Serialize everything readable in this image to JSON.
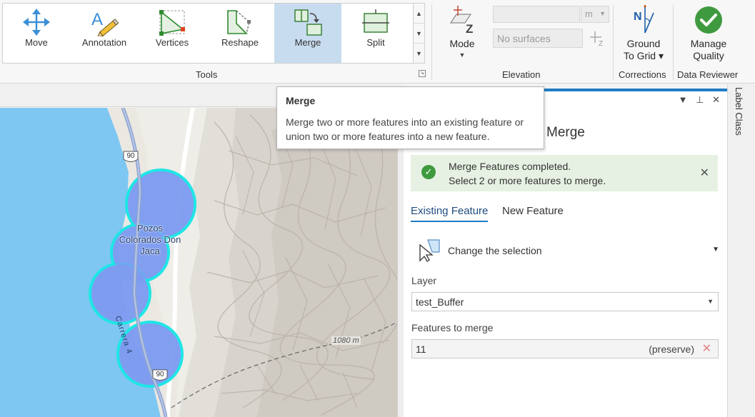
{
  "ribbon": {
    "tools": [
      {
        "label": "Move",
        "icon": "move-icon"
      },
      {
        "label": "Annotation",
        "icon": "annotation-icon"
      },
      {
        "label": "Vertices",
        "icon": "vertices-icon"
      },
      {
        "label": "Reshape",
        "icon": "reshape-icon"
      },
      {
        "label": "Merge",
        "icon": "merge-icon",
        "active": true
      },
      {
        "label": "Split",
        "icon": "split-icon"
      }
    ],
    "tools_group_label": "Tools",
    "elevation": {
      "mode_label": "Mode",
      "unit_value": "m",
      "surface_placeholder": "No surfaces",
      "group_label": "Elevation"
    },
    "corrections": {
      "button_label": "Ground To Grid",
      "group_label": "Corrections"
    },
    "data_reviewer": {
      "button_label": "Manage Quality",
      "group_label": "Data Reviewer"
    }
  },
  "tooltip": {
    "title": "Merge",
    "body": "Merge two or more features into an existing feature or union two or more features into a new feature."
  },
  "map": {
    "place_label_1": "Pozos",
    "place_label_2": "Colorados Don",
    "place_label_3": "Jaca",
    "road_label": "Carrera 4",
    "shield_top": "90",
    "shield_bottom": "90",
    "contour_label": "1080 m"
  },
  "pane": {
    "title": "Merge",
    "message_line1": "Merge Features completed.",
    "message_line2": "Select 2 or more features to merge.",
    "tabs": [
      "Existing Feature",
      "New Feature"
    ],
    "change_selection_label": "Change the selection",
    "layer_label": "Layer",
    "layer_value": "test_Buffer",
    "features_label": "Features to merge",
    "features_count": "11",
    "features_tag": "(preserve)"
  },
  "side_panel": {
    "tab_label": "Label Class"
  },
  "colors": {
    "accent": "#1f7cc4",
    "buffer_fill": "#7f9cf0",
    "buffer_outline": "#1ee6e6",
    "water": "#7ec7f2",
    "success": "#3f9a3f"
  }
}
